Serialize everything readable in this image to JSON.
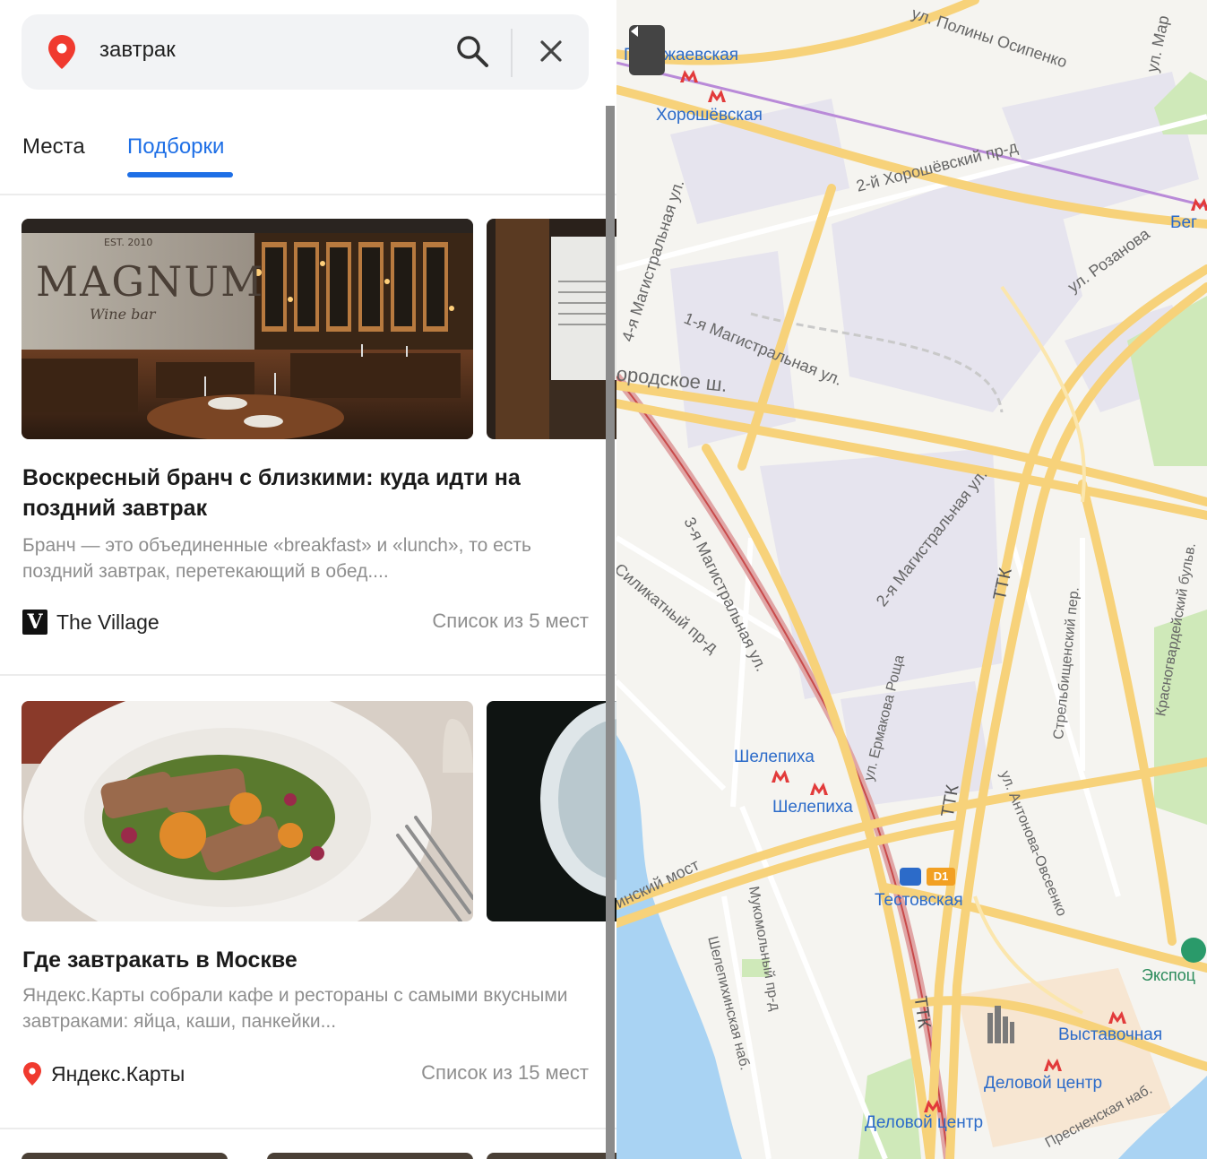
{
  "search": {
    "query": "завтрак"
  },
  "tabs": [
    {
      "label": "Места",
      "active": false
    },
    {
      "label": "Подборки",
      "active": true
    }
  ],
  "colors": {
    "accent": "#1e6fe6",
    "pin": "#f03a2f",
    "metro": "#2c6bc9",
    "road": "#f7d27a",
    "water": "#a9d3f3",
    "park": "#cfe9b9"
  },
  "cards": [
    {
      "image": "MAGNUM",
      "image_caption": "Wine bar",
      "image_year": "EST. 2010",
      "title": "Воскресный бранч с близкими: куда идти на поздний завтрак",
      "description": "Бранч — это объединенные «breakfast» и «lunch», то есть поздний завтрак, перетекающий в обед....",
      "source": "The Village",
      "source_logo": "V",
      "count": "Список из 5 мест"
    },
    {
      "title": "Где завтракать в Москве",
      "description": "Яндекс.Карты собрали кафе и рестораны с самыми вкусными завтраками: яйца, каши, панкейки...",
      "source": "Яндекс.Карты",
      "count": "Список из 15 мест"
    }
  ],
  "map": {
    "metro": [
      "Полежаевская",
      "Хорошёвская",
      "Шелепиха",
      "Шелепиха",
      "Тестовская",
      "Выставочная",
      "Деловой центр",
      "Деловой центр",
      "Бег"
    ],
    "streets": [
      "ул. Полины Осипенко",
      "ул. Мар",
      "2-й Хорошёвский пр-д",
      "ул. Розанова",
      "4-я Магистральная ул.",
      "1-я Магистральная ул.",
      "ородское ш.",
      "3-я Магистральная ул.",
      "2-я Магистральная ул.",
      "Силикатный пр-д",
      "ТТК",
      "ТТК",
      "ТТК",
      "Стрельбищенский пер.",
      "Красногвардейский бульв.",
      "ул. Ермакова Роща",
      "ул. Антонова-Овсеенко",
      "инский мост",
      "Мукомольный пр-д",
      "Шелепихинская наб.",
      "Экспоц",
      "Пресненская наб.",
      "D1"
    ]
  }
}
